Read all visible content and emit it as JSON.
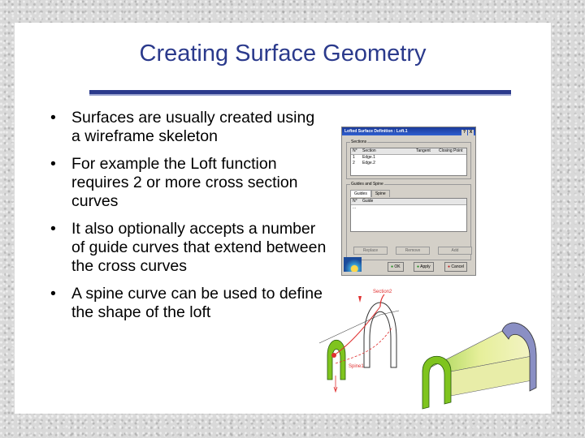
{
  "slide": {
    "title": "Creating Surface Geometry",
    "bullets": [
      "Surfaces are usually created using a wireframe skeleton",
      "For example the Loft function requires 2 or more cross section curves",
      "It also optionally accepts a number of guide curves that extend between the cross curves",
      "A spine curve can be used to define the shape of the loft"
    ],
    "bullet_char": "•"
  },
  "dialog": {
    "title": "Lofted Surface Definition : Loft.1",
    "title_buttons": [
      "?",
      "X"
    ],
    "sections_label": "Sections",
    "sections_headers": [
      "N°",
      "Section",
      "Tangent",
      "Closing Point"
    ],
    "sections_rows": [
      [
        "1",
        "Edge.1"
      ],
      [
        "2",
        "Edge.2"
      ]
    ],
    "guides_group_label": "Guides and Spine",
    "tabs": [
      "Guides",
      "Spine"
    ],
    "guides_headers": [
      "N°",
      "Guide"
    ],
    "guides_rows": [
      [
        "...",
        ""
      ]
    ],
    "sections_buttons": [
      "Replace",
      "Remove",
      "Add"
    ],
    "ok_label": "OK",
    "apply_label": "Apply",
    "cancel_label": "Cancel"
  },
  "colors": {
    "title": "#2b3a8c",
    "surface_green": "#7fc41e",
    "surface_yellow": "#eef0b0",
    "end_cap": "#8a8fc4",
    "curve_red": "#e03030"
  },
  "labels": {
    "section2": "Section2",
    "spine": "Spine1"
  }
}
